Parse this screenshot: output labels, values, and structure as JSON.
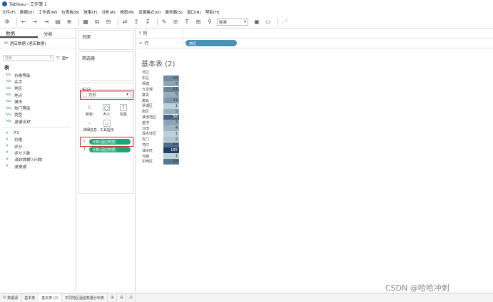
{
  "window": {
    "title": "Tableau - 工作簿 1"
  },
  "menu": [
    "文件(F)",
    "数据(D)",
    "工作表(W)",
    "仪表板(B)",
    "故事(T)",
    "分析(A)",
    "地图(M)",
    "设置格式(O)",
    "服务器(S)",
    "窗口(N)",
    "帮助(H)"
  ],
  "toolbar": {
    "fit_value": "标准"
  },
  "left_pane": {
    "tabs": [
      "数据",
      "分析"
    ],
    "datasource": "酒店数据 (酒店数据)",
    "search_placeholder": "搜索",
    "section_title": "表",
    "dimensions": [
      {
        "label": "价格等级",
        "icon": "Abc"
      },
      {
        "label": "名字",
        "icon": "Abc"
      },
      {
        "label": "地区",
        "icon": "Abc"
      },
      {
        "label": "地点",
        "icon": "Abc"
      },
      {
        "label": "城市",
        "icon": "Abc"
      },
      {
        "label": "热门等级",
        "icon": "Abc"
      },
      {
        "label": "类型",
        "icon": "Abc"
      },
      {
        "label": "度量名称",
        "icon": "Abc"
      }
    ],
    "measures": [
      {
        "label": "F1",
        "icon": "#"
      },
      {
        "label": "价格",
        "icon": "#"
      },
      {
        "label": "评分",
        "icon": "#"
      },
      {
        "label": "评分人数",
        "icon": "#"
      },
      {
        "label": "酒店数据 (计数)",
        "icon": "#"
      },
      {
        "label": "度量值",
        "icon": "#"
      }
    ]
  },
  "cards": {
    "pages": "页面",
    "filters": "筛选器",
    "marks": "标记",
    "mark_type": "方形",
    "mark_buttons": [
      "颜色",
      "大小",
      "标签",
      "详细信息",
      "工具提示"
    ],
    "pills": [
      "计数(酒店数据)",
      "计数(酒店数据)"
    ]
  },
  "shelves": {
    "columns_label": "列",
    "rows_label": "行",
    "rows_pill": "地区"
  },
  "sheet": {
    "title": "基本表 (2)",
    "column_header": "地区",
    "rows": [
      {
        "label": "东区",
        "value": 16
      },
      {
        "label": "观塘",
        "value": 7
      },
      {
        "label": "九龙城",
        "value": 21
      },
      {
        "label": "葵青",
        "value": 5
      },
      {
        "label": "离岛",
        "value": 11
      },
      {
        "label": "罗湖区",
        "value": 1
      },
      {
        "label": "南区",
        "value": 5
      },
      {
        "label": "其他地区",
        "value": 56
      },
      {
        "label": "荃湾",
        "value": 7
      },
      {
        "label": "沙田",
        "value": 4
      },
      {
        "label": "深水埗区",
        "value": 1
      },
      {
        "label": "屯门",
        "value": 2
      },
      {
        "label": "湾仔",
        "value": 41
      },
      {
        "label": "油尖旺",
        "value": 185
      },
      {
        "label": "元朗",
        "value": 1
      },
      {
        "label": "中西区",
        "value": 33
      }
    ]
  },
  "statusbar": [
    "数据源",
    "基本表",
    "基本表 (2)",
    "不同地区酒店数量分布表"
  ],
  "watermark": "CSDN @哈哈冲刺"
}
